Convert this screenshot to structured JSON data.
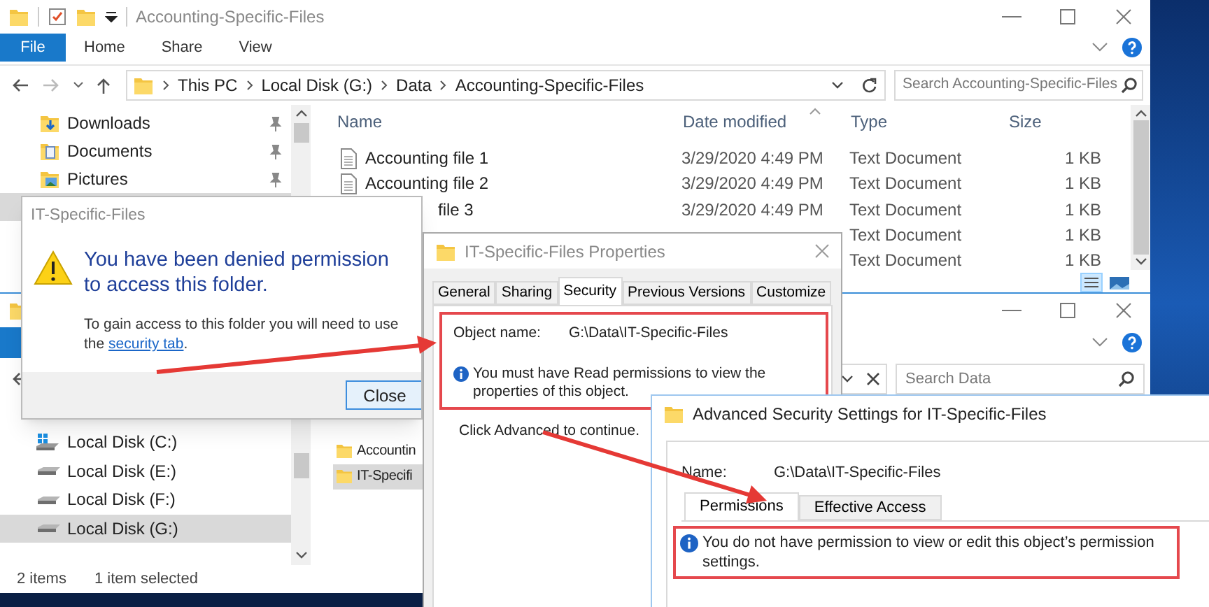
{
  "explorer_main": {
    "title": "Accounting-Specific-Files",
    "ribbon": {
      "file_button": "File",
      "tabs": [
        "Home",
        "Share",
        "View"
      ]
    },
    "breadcrumb": [
      "This PC",
      "Local Disk (G:)",
      "Data",
      "Accounting-Specific-Files"
    ],
    "search": {
      "placeholder": "Search Accounting-Specific-Files"
    },
    "nav_items": [
      {
        "label": "Downloads",
        "kind": "downloads",
        "pinned": true,
        "selected": false
      },
      {
        "label": "Documents",
        "kind": "documents",
        "pinned": true,
        "selected": false
      },
      {
        "label": "Pictures",
        "kind": "pictures",
        "pinned": true,
        "selected": false
      },
      {
        "kind": "folder",
        "pinned": false,
        "selected": true
      }
    ],
    "columns": [
      "Name",
      "Date modified",
      "Type",
      "Size"
    ],
    "rows": [
      {
        "name": "Accounting file 1",
        "cut": false,
        "date": "3/29/2020 4:49 PM",
        "type": "Text Document",
        "size": "1 KB"
      },
      {
        "name": "Accounting file 2",
        "cut": false,
        "date": "3/29/2020 4:49 PM",
        "type": "Text Document",
        "size": "1 KB"
      },
      {
        "name": "file 3",
        "cut": true,
        "date": "3/29/2020 4:49 PM",
        "type": "Text Document",
        "size": "1 KB"
      },
      {
        "type": "Text Document",
        "size": "1 KB"
      },
      {
        "type": "Text Document",
        "size": "1 KB"
      }
    ]
  },
  "explorer_data": {
    "search": {
      "placeholder": "Search Data"
    },
    "nav_items": [
      {
        "label": "Local Disk (C:)",
        "kind": "system_drive",
        "selected": false
      },
      {
        "label": "Local Disk (E:)",
        "kind": "drive",
        "selected": false
      },
      {
        "label": "Local Disk (F:)",
        "kind": "drive",
        "selected": false
      },
      {
        "label": "Local Disk (G:)",
        "kind": "drive",
        "selected": true
      }
    ],
    "files": [
      {
        "name": "Accountin",
        "selected": false
      },
      {
        "name": "IT-Specifi",
        "selected": true
      }
    ],
    "status_bar": [
      "2 items",
      "1 item selected"
    ]
  },
  "denied_dialog": {
    "title": "IT-Specific-Files",
    "heading": "You have been denied permission to access this folder.",
    "body": "To gain access to this folder you will need to use the",
    "link": "security tab",
    "after_link": ".",
    "button": "Close"
  },
  "properties_dialog": {
    "title": "IT-Specific-Files Properties",
    "tabs": [
      {
        "label": "General",
        "selected": false
      },
      {
        "label": "Sharing",
        "selected": false
      },
      {
        "label": "Security",
        "selected": true
      },
      {
        "label": "Previous Versions",
        "selected": false
      },
      {
        "label": "Customize",
        "selected": false
      }
    ],
    "object_name_label": "Object name:",
    "object_name": "G:\\Data\\IT-Specific-Files",
    "notice": "You must have Read permissions to view the properties of this object.",
    "hint": "Click Advanced to continue."
  },
  "advanced_dialog": {
    "title": "Advanced Security Settings for IT-Specific-Files",
    "name_label": "Name:",
    "name": "G:\\Data\\IT-Specific-Files",
    "tabs": [
      {
        "label": "Permissions",
        "selected": true
      },
      {
        "label": "Effective Access",
        "selected": false
      }
    ],
    "notice": "You do not have permission to view or edit this object’s permission settings."
  }
}
